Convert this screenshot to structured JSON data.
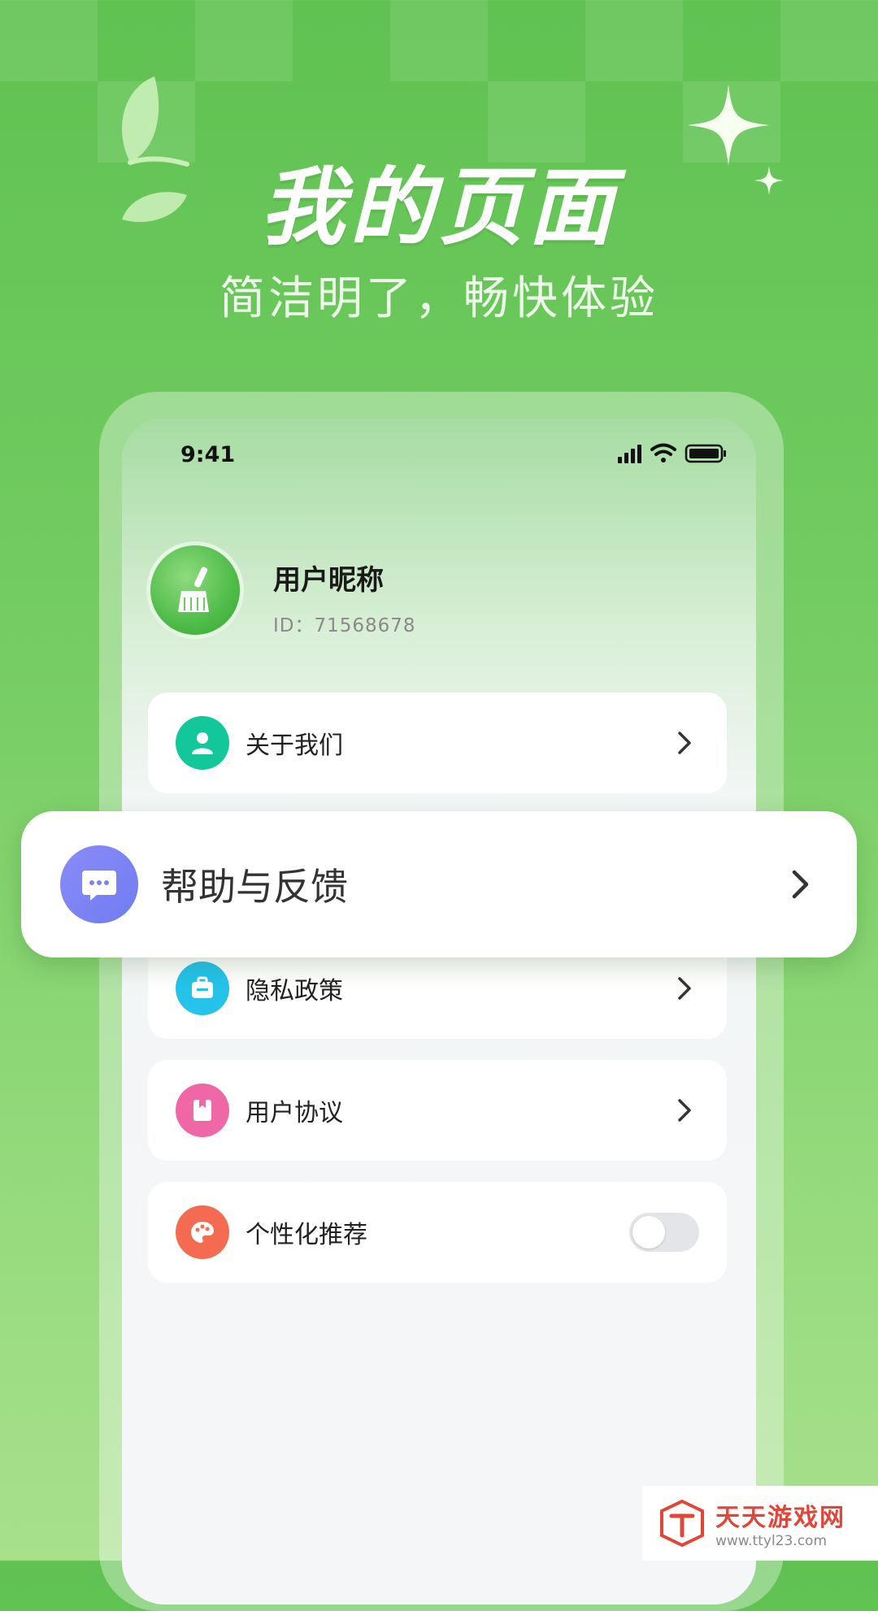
{
  "banner": {
    "title": "我的页面",
    "subtitle": "简洁明了，畅快体验"
  },
  "status_bar": {
    "time": "9:41"
  },
  "profile": {
    "nickname": "用户昵称",
    "id_text": "ID：71568678"
  },
  "menu": {
    "items": [
      {
        "label": "关于我们",
        "icon": "user-icon",
        "color": "#12c79a"
      },
      {
        "label": "隐私政策",
        "icon": "briefcase-icon",
        "color": "#25c2ea"
      },
      {
        "label": "用户协议",
        "icon": "document-icon",
        "color": "#f067a6"
      },
      {
        "label": "个性化推荐",
        "icon": "palette-icon",
        "color": "#f56b52",
        "toggle_on": false
      }
    ]
  },
  "highlight": {
    "label": "帮助与反馈",
    "icon": "chat-icon",
    "color": "#7b82f4"
  },
  "watermark": {
    "title": "天天游戏网",
    "url": "www.ttyl23.com"
  }
}
